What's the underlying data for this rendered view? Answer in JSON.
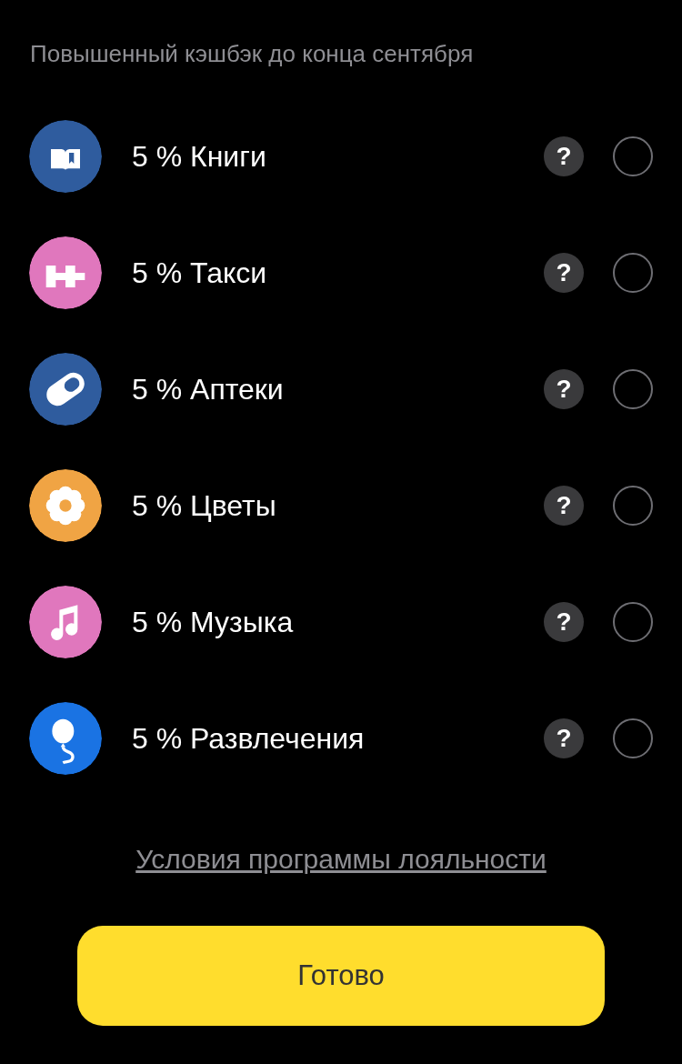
{
  "header": "Повышенный кэшбэк до конца сентября",
  "categories": [
    {
      "label": "5 % Книги",
      "kind": "book",
      "color": "#2f5c9e",
      "selected": false,
      "help": "?"
    },
    {
      "label": "5 % Такси",
      "kind": "taxi",
      "color": "#e077bd",
      "selected": false,
      "help": "?"
    },
    {
      "label": "5 % Аптеки",
      "kind": "pill",
      "color": "#2f5c9e",
      "selected": false,
      "help": "?"
    },
    {
      "label": "5 % Цветы",
      "kind": "flower",
      "color": "#f0a444",
      "selected": false,
      "help": "?"
    },
    {
      "label": "5 % Музыка",
      "kind": "music",
      "color": "#e077bd",
      "selected": false,
      "help": "?"
    },
    {
      "label": "5 % Развлечения",
      "kind": "balloon",
      "color": "#1a73e3",
      "selected": false,
      "help": "?"
    }
  ],
  "link": "Условия программы лояльности",
  "button": "Готово"
}
